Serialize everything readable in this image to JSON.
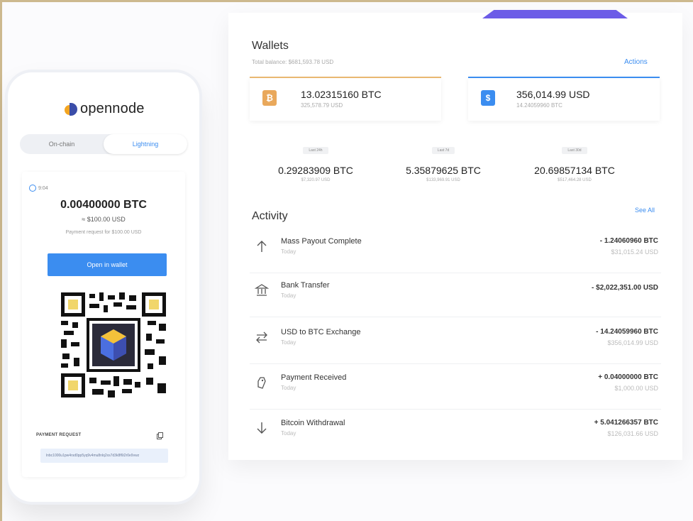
{
  "brand": {
    "name": "opennode"
  },
  "phone": {
    "tabs": [
      "On-chain",
      "Lightning"
    ],
    "timer": "9:04",
    "amount": "0.00400000 BTC",
    "usd": "≈ $100.00 USD",
    "request_note": "Payment request for $100.00 USD",
    "open_button": "Open in wallet",
    "payment_request_label": "PAYMENT REQUEST",
    "payment_request_value": "lnbc1000u1pw4rsd0pp5yq9v4mu8nlq2xs7d3k8f6t2r0e9vwz"
  },
  "wallets": {
    "title": "Wallets",
    "total_balance": "Total balance: $681,593.78 USD",
    "actions": "Actions",
    "cards": [
      {
        "amount": "13.02315160 BTC",
        "sub": "325,578.79 USD",
        "icon": "bitcoin-icon"
      },
      {
        "amount": "356,014.99 USD",
        "sub": "14.24059960 BTC",
        "icon": "dollar-icon"
      }
    ]
  },
  "stats": [
    {
      "period": "Last 24h",
      "value": "0.29283909 BTC",
      "sub": "$7,320.97 USD"
    },
    {
      "period": "Last 7d",
      "value": "5.35879625 BTC",
      "sub": "$133,969.91 USD"
    },
    {
      "period": "Last 30d",
      "value": "20.69857134 BTC",
      "sub": "$517,464.28 USD"
    }
  ],
  "activity": {
    "title": "Activity",
    "see_all": "See All",
    "items": [
      {
        "name": "Mass Payout Complete",
        "date": "Today",
        "amount": "- 1.24060960 BTC",
        "sub": "$31,015.24 USD",
        "icon": "arrow-up-icon"
      },
      {
        "name": "Bank Transfer",
        "date": "Today",
        "amount": "- $2,022,351.00 USD",
        "sub": "",
        "icon": "bank-icon"
      },
      {
        "name": "USD to BTC Exchange",
        "date": "Today",
        "amount": "- 14.24059960 BTC",
        "sub": "$356,014.99 USD",
        "icon": "exchange-icon"
      },
      {
        "name": "Payment Received",
        "date": "Today",
        "amount": "+ 0.04000000 BTC",
        "sub": "$1,000.00 USD",
        "icon": "tag-icon"
      },
      {
        "name": "Bitcoin Withdrawal",
        "date": "Today",
        "amount": "+ 5.041266357 BTC",
        "sub": "$126,031.66 USD",
        "icon": "arrow-down-icon"
      }
    ]
  },
  "colors": {
    "accent": "#3b8df0",
    "bitcoin": "#e9a85b",
    "border": "#cdb98f",
    "purple": "#6c5ce7"
  }
}
